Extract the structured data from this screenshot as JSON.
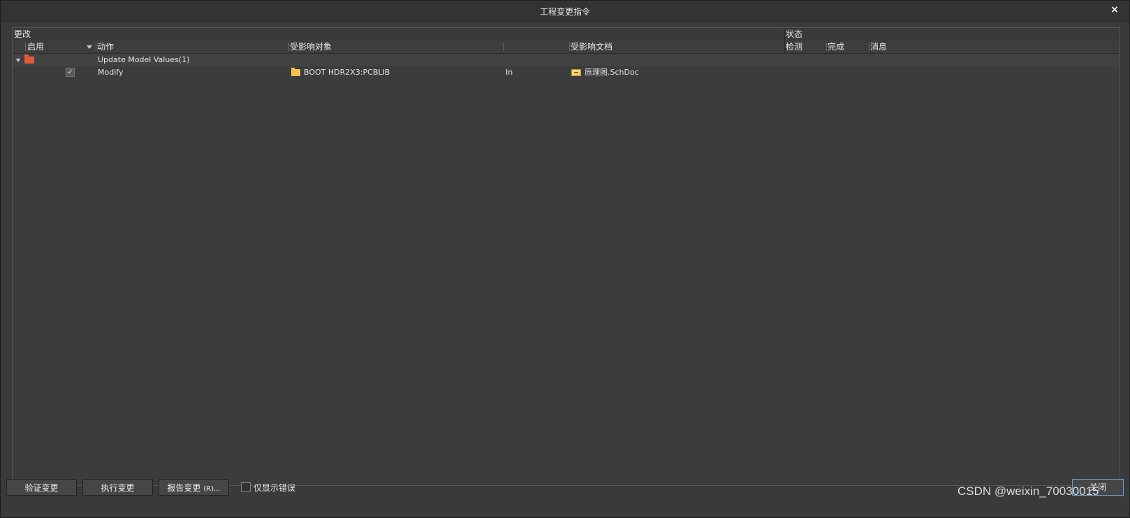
{
  "window": {
    "title": "工程变更指令",
    "close_glyph": "×"
  },
  "table": {
    "group_headers": {
      "changes": "更改",
      "status": "状态"
    },
    "columns": {
      "enable": "启用",
      "action": "动作",
      "affected_object": "受影响对象",
      "affected_document": "受影响文档",
      "check": "检测",
      "done": "完成",
      "message": "消息"
    },
    "group_row": {
      "label": "Update Model Values(1)"
    },
    "rows": [
      {
        "enabled": true,
        "action": "Modify",
        "affected_object": "BOOT HDR2X3:PCBLIB",
        "relation": "In",
        "affected_document": "原理图.SchDoc"
      }
    ]
  },
  "footer": {
    "validate_button": "验证变更",
    "execute_button": "执行变更",
    "report_button": "报告变更",
    "report_shortcut": "(R)...",
    "only_errors_label": "仅显示错误",
    "close_button": "关闭",
    "watermark": "CSDN @weixin_70030015"
  },
  "colors": {
    "window_bg": "#3a3a3a",
    "group_folder": "#e8583a",
    "object_folder": "#f2c14e",
    "close_focus_border": "#6aa0d8"
  },
  "icons": {
    "group": "folder-red-icon",
    "object": "folder-yellow-icon",
    "document": "schdoc-icon"
  }
}
